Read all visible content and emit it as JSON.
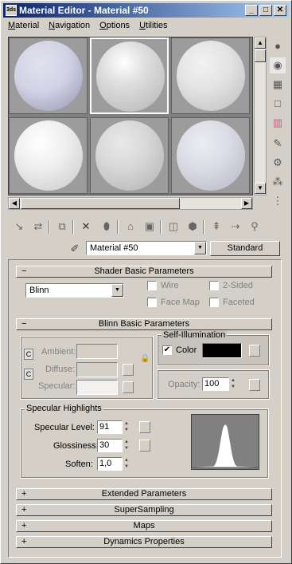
{
  "window": {
    "title": "Material Editor - Material #50",
    "controls": [
      "_",
      "□",
      "✕"
    ]
  },
  "menu": [
    {
      "label": "Material",
      "u": "M"
    },
    {
      "label": "Navigation",
      "u": "N"
    },
    {
      "label": "Options",
      "u": "O"
    },
    {
      "label": "Utilities",
      "u": "U"
    }
  ],
  "material": {
    "name": "Material #50",
    "type": "Standard"
  },
  "shader_basic": {
    "header": "Shader Basic Parameters",
    "sign": "−",
    "shader": "Blinn",
    "wire": "Wire",
    "two_sided": "2-Sided",
    "face_map": "Face Map",
    "faceted": "Faceted"
  },
  "blinn_basic": {
    "header": "Blinn Basic Parameters",
    "sign": "−",
    "ambient": "Ambient:",
    "diffuse": "Diffuse:",
    "specular": "Specular:",
    "self_illum_title": "Self-Illumination",
    "color_label": "Color",
    "color_checked": "✔",
    "opacity_label": "Opacity:",
    "opacity_value": "100",
    "colors": {
      "ambient": "#d4d0c8",
      "diffuse": "#d4d0c8",
      "specular": "#f2f1ef",
      "self_illum": "#000000"
    }
  },
  "specular_highlights": {
    "title": "Specular Highlights",
    "level_label": "Specular Level:",
    "level_value": "91",
    "gloss_label": "Glossiness:",
    "gloss_value": "30",
    "soften_label": "Soften:",
    "soften_value": "1,0"
  },
  "rollouts": [
    {
      "sign": "+",
      "label": "Extended Parameters"
    },
    {
      "sign": "+",
      "label": "SuperSampling"
    },
    {
      "sign": "+",
      "label": "Maps"
    },
    {
      "sign": "+",
      "label": "Dynamics Properties"
    }
  ],
  "icons": {
    "app": "3ds-max-icon",
    "sidebar": [
      "sample-type-sphere-icon",
      "backlight-icon",
      "background-checker-icon",
      "sample-uv-tiling-icon",
      "video-color-check-icon",
      "make-preview-icon",
      "options-icon",
      "select-by-material-icon",
      "material-map-navigator-icon"
    ],
    "toolbar": [
      "get-material-icon",
      "put-to-scene-icon",
      "assign-to-selection-icon",
      "reset-map-icon",
      "make-unique-icon",
      "put-to-library-icon",
      "material-effects-channel-icon",
      "show-map-in-viewport-icon",
      "show-end-result-icon",
      "go-to-parent-icon",
      "go-forward-to-sibling-icon",
      "pick-material-icon"
    ]
  }
}
